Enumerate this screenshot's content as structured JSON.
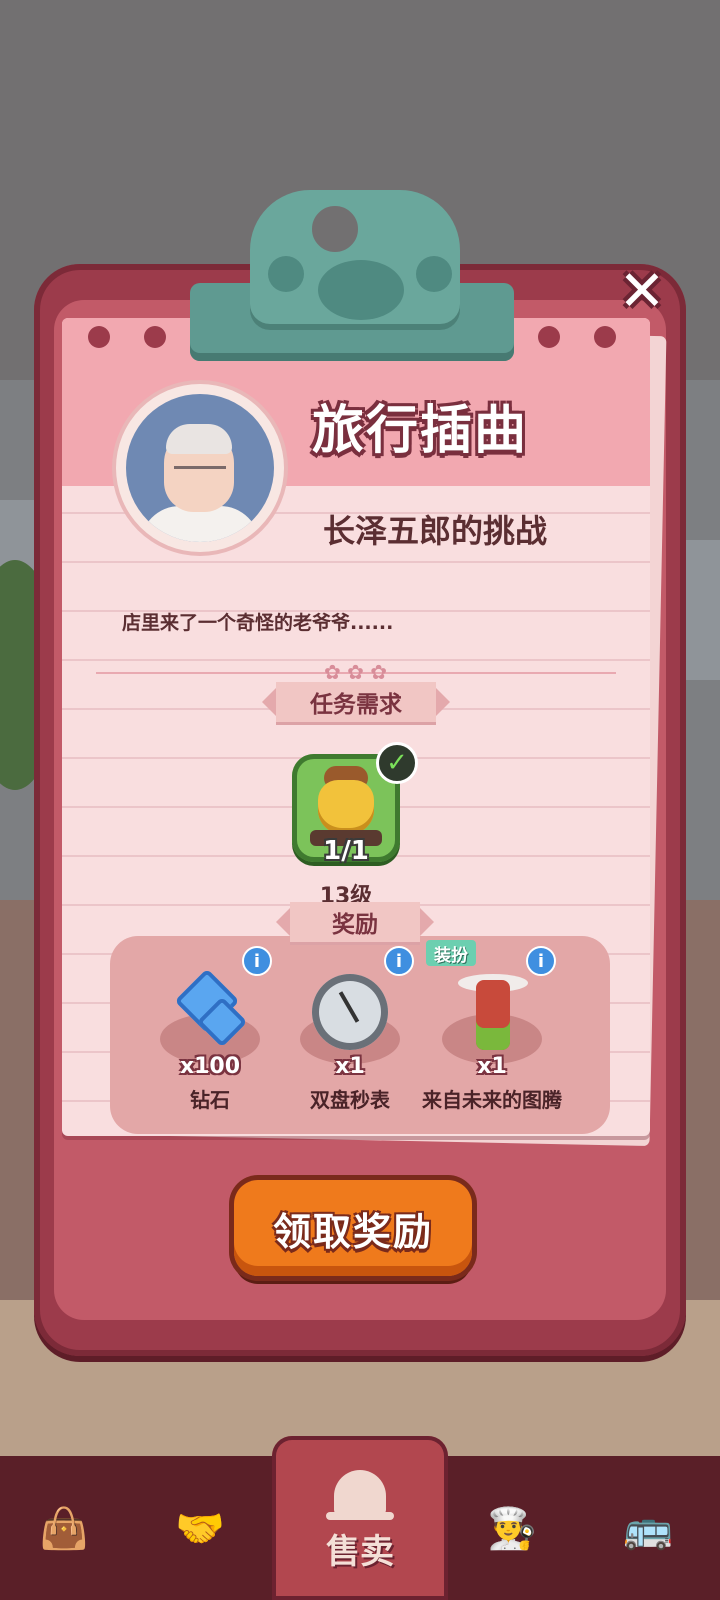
{
  "modal": {
    "title": "旅行插曲",
    "subtitle": "长泽五郎的挑战",
    "description": "店里来了一个奇怪的老爷爷......",
    "close_icon": "close-icon"
  },
  "task": {
    "header": "任务需求",
    "progress": "1/1",
    "level": "13级",
    "completed": true
  },
  "rewards": {
    "header": "奖励",
    "items": [
      {
        "name": "钻石",
        "qty": "x100",
        "icon": "diamond-icon"
      },
      {
        "name": "双盘秒表",
        "qty": "x1",
        "icon": "stopwatch-icon"
      },
      {
        "name": "来自未来的图腾",
        "qty": "x1",
        "icon": "totem-icon",
        "tag": "装扮"
      }
    ],
    "info_glyph": "i"
  },
  "claim_button": {
    "label": "领取奖励"
  },
  "nav": {
    "items": [
      {
        "icon": "bag-icon"
      },
      {
        "icon": "handshake-icon"
      },
      {
        "icon": "service-bell-icon",
        "label": "售卖",
        "active": true
      },
      {
        "icon": "chef-icon"
      },
      {
        "icon": "bus-icon"
      }
    ]
  },
  "colors": {
    "modal_frame": "#9c3b4b",
    "paper": "#f9dedf",
    "claim_button": "#ef7a1c",
    "nav_bg": "#5a1f28"
  }
}
